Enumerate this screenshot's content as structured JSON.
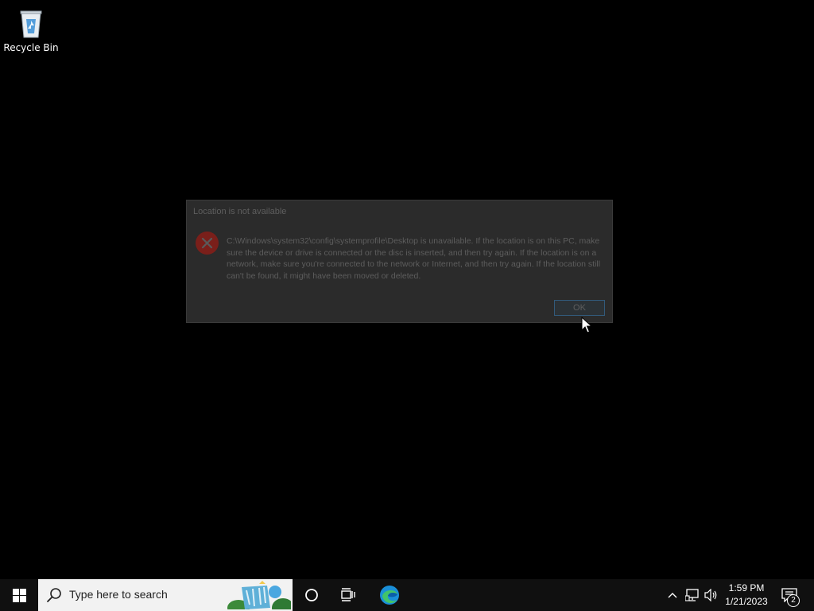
{
  "desktop": {
    "recycle_bin_label": "Recycle Bin"
  },
  "dialog": {
    "title": "Location is not available",
    "message": "C:\\Windows\\system32\\config\\systemprofile\\Desktop is unavailable. If the location is on this PC, make sure the device or drive is connected or the disc is inserted, and then try again. If the location is on a network, make sure you're connected to the network or Internet, and then try again. If the location still can't be found, it might have been moved or deleted.",
    "ok_label": "OK",
    "icon": "error-icon"
  },
  "taskbar": {
    "search_placeholder": "Type here to search",
    "time": "1:59 PM",
    "date": "1/21/2023",
    "notification_count": "2",
    "icons": [
      "windows-start-icon",
      "search-icon",
      "cortana-icon",
      "task-view-icon",
      "edge-icon",
      "chevron-up-icon",
      "network-icon",
      "volume-icon",
      "notification-icon"
    ]
  },
  "colors": {
    "desktop_bg": "#000000",
    "taskbar_bg": "#101010",
    "dialog_bg": "#2b2b2b",
    "error_red": "#c0392b",
    "ok_border": "#325a7a"
  }
}
